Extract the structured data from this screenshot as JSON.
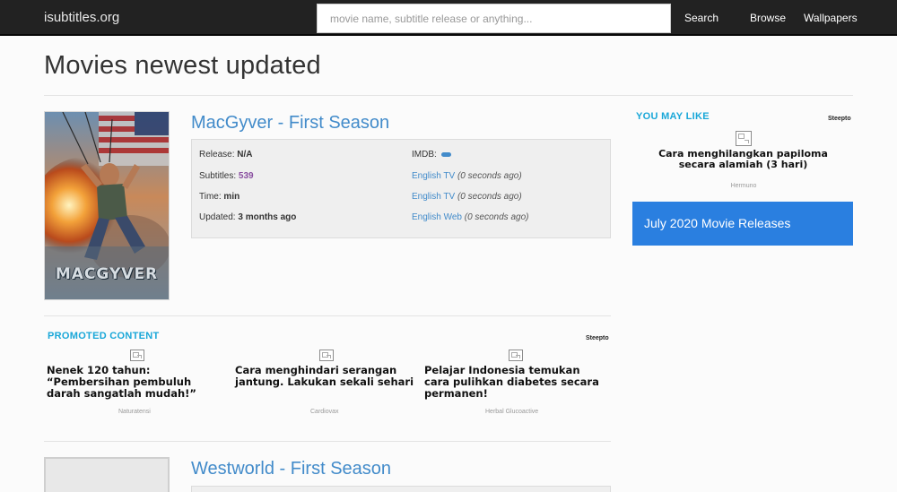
{
  "navbar": {
    "brand": "isubtitles.org",
    "search_placeholder": "movie name, subtitle release or anything...",
    "search_label": "Search",
    "browse_label": "Browse",
    "wallpapers_label": "Wallpapers"
  },
  "page": {
    "title": "Movies newest updated"
  },
  "movies": [
    {
      "title": "MacGyver - First Season",
      "poster_text": "MACGYVER",
      "release_label": "Release:",
      "release_value": "N/A",
      "imdb_label": "IMDB:",
      "subtitles_label": "Subtitles:",
      "subtitles_value": "539",
      "time_label": "Time:",
      "time_value": "min",
      "updated_label": "Updated:",
      "updated_value": "3 months ago",
      "subs": [
        {
          "lang": "English TV",
          "time": "(0 seconds ago)"
        },
        {
          "lang": "English TV",
          "time": "(0 seconds ago)"
        },
        {
          "lang": "English Web",
          "time": "(0 seconds ago)"
        }
      ]
    },
    {
      "title": "Westworld - First Season"
    }
  ],
  "promoted": {
    "heading": "PROMOTED CONTENT",
    "provider": "Steepto",
    "items": [
      {
        "title": "Nenek 120 tahun: “Pembersihan pembuluh darah sangatlah mudah!”",
        "source": "Naturatensi"
      },
      {
        "title": "Cara menghindari serangan jantung. Lakukan sekali sehari",
        "source": "Cardiovax"
      },
      {
        "title": "Pelajar Indonesia temukan cara pulihkan diabetes secara permanen!",
        "source": "Herbal Glucoactive"
      }
    ]
  },
  "sidebar": {
    "heading": "YOU MAY LIKE",
    "provider": "Steepto",
    "item_title": "Cara menghilangkan papiloma secara alamiah (3 hari)",
    "item_source": "Hermuno",
    "banner": "July 2020 Movie Releases"
  },
  "colors": {
    "navbar": "#222222",
    "link": "#428bca",
    "accent_blue": "#2a7fe0",
    "promo_heading": "#19a7d8",
    "subs_count": "#8a4fa0"
  }
}
